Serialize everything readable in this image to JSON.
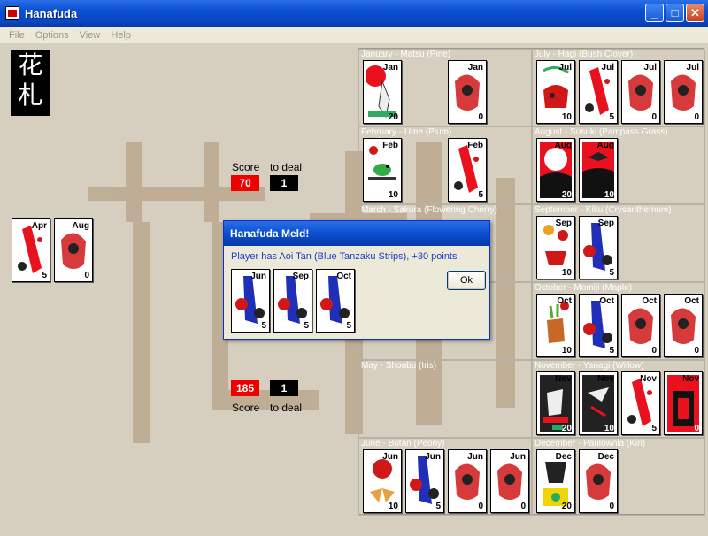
{
  "window": {
    "title": "Hanafuda"
  },
  "menu": [
    "File",
    "Options",
    "View",
    "Help"
  ],
  "logo_text": "花札",
  "opponent": {
    "score": "70",
    "to_deal": "1",
    "score_label": "Score",
    "deal_label": "to deal"
  },
  "player": {
    "score": "185",
    "to_deal": "1",
    "score_label": "Score",
    "deal_label": "to deal"
  },
  "opponent_captured": [
    {
      "month": "Apr",
      "points": "5",
      "kind": "ribbon-red"
    },
    {
      "month": "Aug",
      "points": "0",
      "kind": "plain"
    }
  ],
  "months": [
    {
      "label": "January - Matsu (Pine)",
      "cards": [
        {
          "month": "Jan",
          "points": "20",
          "kind": "crane"
        },
        {
          "month": "Jan",
          "points": "0",
          "kind": "plain"
        }
      ]
    },
    {
      "label": "July - Hagi (Bush Clover)",
      "cards": [
        {
          "month": "Jul",
          "points": "10",
          "kind": "boar"
        },
        {
          "month": "Jul",
          "points": "5",
          "kind": "ribbon-red"
        },
        {
          "month": "Jul",
          "points": "0",
          "kind": "plain"
        },
        {
          "month": "Jul",
          "points": "0",
          "kind": "plain"
        }
      ]
    },
    {
      "label": "February - Ume (Plum)",
      "cards": [
        {
          "month": "Feb",
          "points": "10",
          "kind": "bird"
        },
        {
          "month": "Feb",
          "points": "5",
          "kind": "ribbon-red"
        }
      ]
    },
    {
      "label": "August - Susuki (Pampass Grass)",
      "cards": [
        {
          "month": "Aug",
          "points": "20",
          "kind": "moon"
        },
        {
          "month": "Aug",
          "points": "10",
          "kind": "geese"
        }
      ]
    },
    {
      "label": "March - Sakura (Flowering Cherry)",
      "cards": []
    },
    {
      "label": "September - Kiku (Crysanthemum)",
      "cards": [
        {
          "month": "Sep",
          "points": "10",
          "kind": "cup"
        },
        {
          "month": "Sep",
          "points": "5",
          "kind": "ribbon-blue"
        }
      ]
    },
    {
      "label": "April",
      "cards": []
    },
    {
      "label": "October - Momiji (Maple)",
      "cards": [
        {
          "month": "Oct",
          "points": "10",
          "kind": "deer"
        },
        {
          "month": "Oct",
          "points": "5",
          "kind": "ribbon-blue"
        },
        {
          "month": "Oct",
          "points": "0",
          "kind": "plain"
        },
        {
          "month": "Oct",
          "points": "0",
          "kind": "plain"
        }
      ]
    },
    {
      "label": "May - Shoubu (Iris)",
      "cards": []
    },
    {
      "label": "November - Yanagi (Willow)",
      "cards": [
        {
          "month": "Nov",
          "points": "20",
          "kind": "rainman"
        },
        {
          "month": "Nov",
          "points": "10",
          "kind": "swallow"
        },
        {
          "month": "Nov",
          "points": "5",
          "kind": "ribbon-red"
        },
        {
          "month": "Nov",
          "points": "0",
          "kind": "storm"
        }
      ]
    },
    {
      "label": "June - Botan (Peony)",
      "cards": [
        {
          "month": "Jun",
          "points": "10",
          "kind": "butterfly"
        },
        {
          "month": "Jun",
          "points": "5",
          "kind": "ribbon-blue"
        },
        {
          "month": "Jun",
          "points": "0",
          "kind": "plain"
        },
        {
          "month": "Jun",
          "points": "0",
          "kind": "plain"
        }
      ]
    },
    {
      "label": "December - Paulownia (Kiri)",
      "cards": [
        {
          "month": "Dec",
          "points": "20",
          "kind": "phoenix"
        },
        {
          "month": "Dec",
          "points": "0",
          "kind": "plain"
        }
      ]
    }
  ],
  "dialog": {
    "title": "Hanafuda Meld!",
    "message": "Player has Aoi Tan (Blue Tanzaku Strips), +30 points",
    "ok": "Ok",
    "cards": [
      {
        "month": "Jun",
        "points": "5"
      },
      {
        "month": "Sep",
        "points": "5"
      },
      {
        "month": "Oct",
        "points": "5"
      }
    ]
  },
  "colors": {
    "table": "#d6cfc0",
    "ribbon_red": "#e8111d",
    "ribbon_blue": "#1f2fb8",
    "flower_red": "#d01818"
  }
}
